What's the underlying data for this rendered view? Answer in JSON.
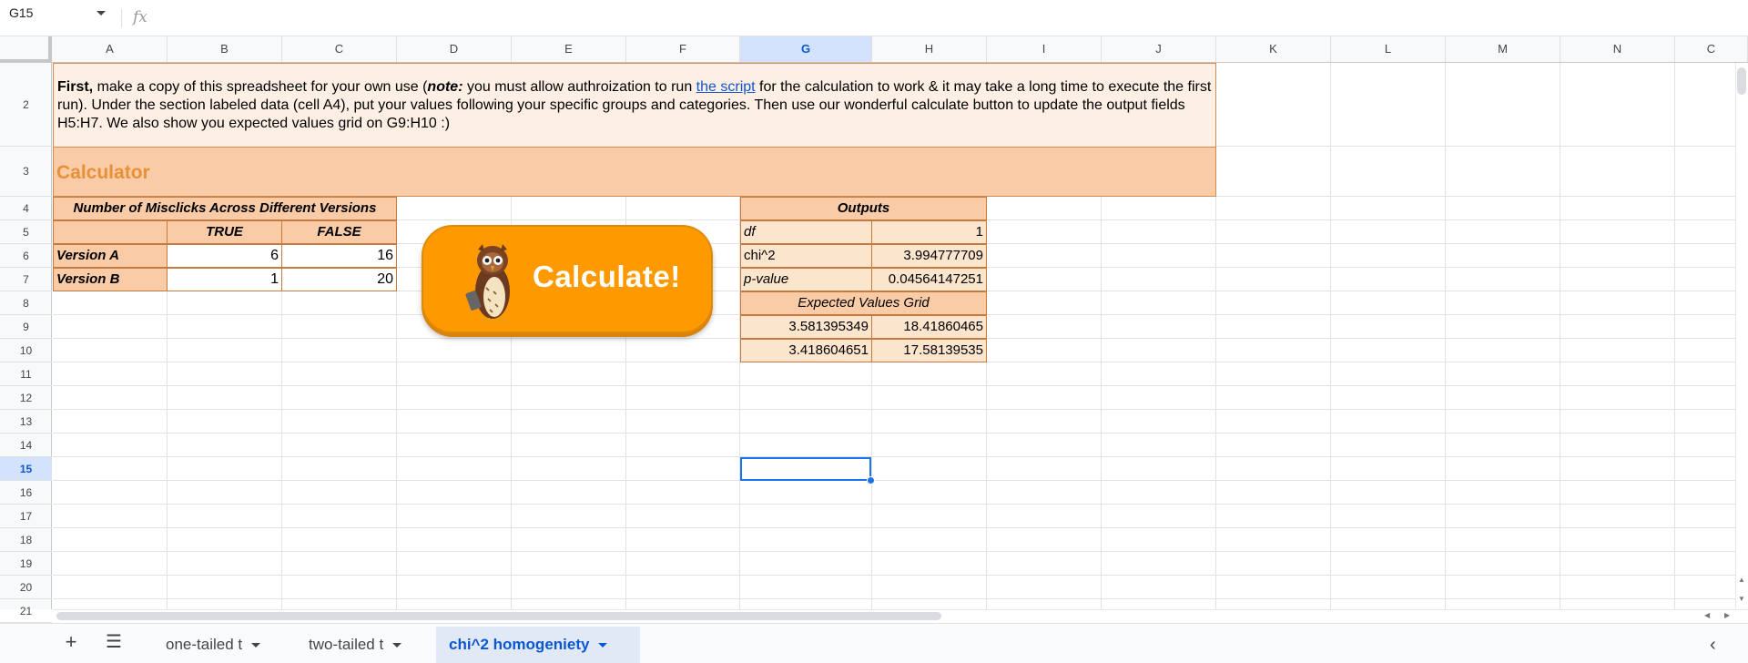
{
  "formula_bar": {
    "name_box": "G15",
    "fx": "fx",
    "formula": ""
  },
  "columns": [
    "A",
    "B",
    "C",
    "D",
    "E",
    "F",
    "G",
    "H",
    "I",
    "J",
    "K",
    "L",
    "M",
    "N",
    "C"
  ],
  "selected_column": "G",
  "rows": [
    "2",
    "3",
    "4",
    "5",
    "6",
    "7",
    "8",
    "9",
    "10",
    "11",
    "12",
    "13",
    "14",
    "15",
    "16",
    "17",
    "18",
    "19",
    "20",
    "21"
  ],
  "selected_row": "15",
  "intro": {
    "first": "First,",
    "part1": " make a copy of this spreadsheet for your own use (",
    "note": "note:",
    "part2": " you must allow authroization to run ",
    "link": "the script",
    "part3": " for the calculation to work & it may take a long time to execute the first run). Under the section labeled data (cell A4), put your values following your specific groups and categories. Then use our wonderful calculate button to update the output fields H5:H7. We also show you expected values grid on G9:H10 :)"
  },
  "calculator_title": "Calculator",
  "data_table": {
    "title": "Number of Misclicks Across Different Versions",
    "col_headers": [
      "TRUE",
      "FALSE"
    ],
    "rows": [
      {
        "label": "Version A",
        "values": [
          "6",
          "16"
        ]
      },
      {
        "label": "Version B",
        "values": [
          "1",
          "20"
        ]
      }
    ]
  },
  "calculate_button": {
    "label": "Calculate!",
    "icon": "owl-icon"
  },
  "outputs": {
    "title": "Outputs",
    "rows": [
      {
        "label": "df",
        "value": "1"
      },
      {
        "label": "chi^2",
        "value": "3.994777709"
      },
      {
        "label": "p-value",
        "value": "0.04564147251"
      }
    ],
    "expected_title": "Expected Values Grid",
    "expected": [
      [
        "3.581395349",
        "18.41860465"
      ],
      [
        "3.418604651",
        "17.58139535"
      ]
    ]
  },
  "sheet_tabs": [
    {
      "label": "one-tailed t",
      "active": false
    },
    {
      "label": "two-tailed t",
      "active": false
    },
    {
      "label": "chi^2 homogeniety",
      "active": true
    }
  ],
  "colors": {
    "header_fill": "#f9cba7",
    "intro_fill": "#fdefe3",
    "title_text": "#e69138",
    "button": "#ff9900",
    "selection": "#1a73e8"
  }
}
